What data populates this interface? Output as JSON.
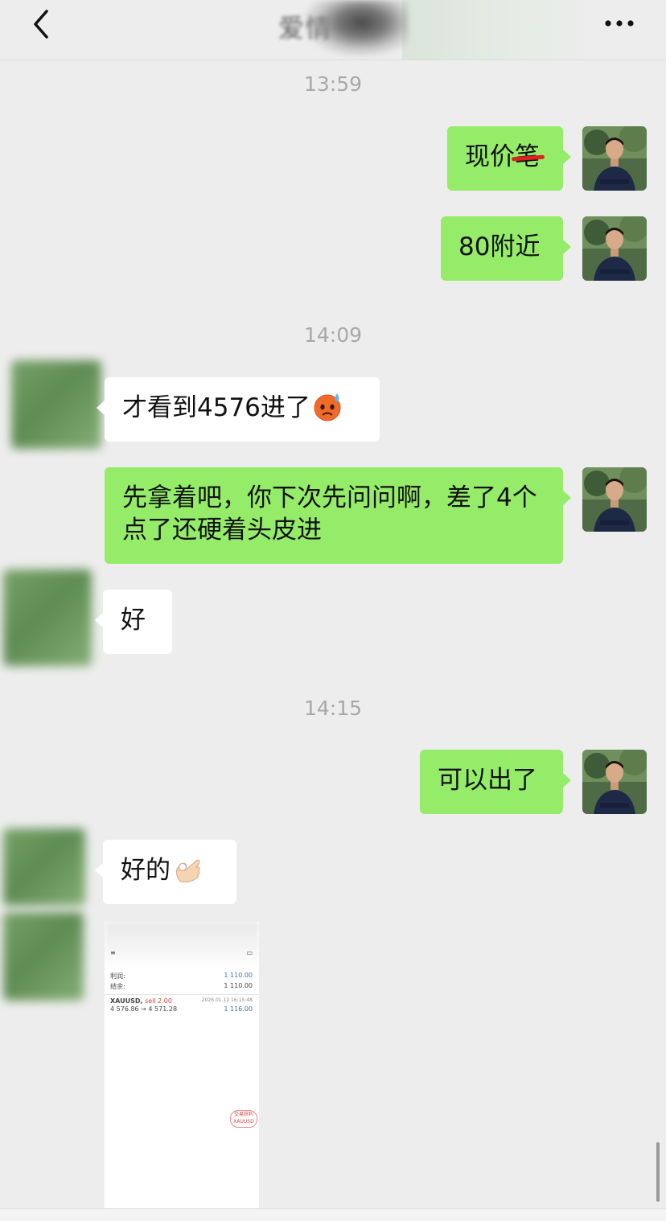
{
  "header": {
    "title": "爱情",
    "back_icon": "chevron-left-icon",
    "more_icon": "more-dots-icon"
  },
  "timestamps": [
    "13:59",
    "14:09",
    "14:15"
  ],
  "messages": [
    {
      "side": "out",
      "text_main": "现价",
      "text_struck": "笔"
    },
    {
      "side": "out",
      "text": "80附近"
    },
    {
      "side": "in",
      "text": "才看到4576进了",
      "emoji": "anxious-face-with-sweat-icon"
    },
    {
      "side": "out",
      "text": "先拿着吧，你下次先问问啊，差了4个点了还硬着头皮进"
    },
    {
      "side": "in",
      "text": "好"
    },
    {
      "side": "out",
      "text": "可以出了"
    },
    {
      "side": "in",
      "text": "好的",
      "emoji": "ok-hand-icon"
    }
  ],
  "screenshot": {
    "label_profit": "利润:",
    "value_profit": "1 110.00",
    "label_balance": "结余:",
    "value_balance": "1 110.00",
    "symbol": "XAUUSD,",
    "action": "sell 2.00",
    "date": "2026.01.12 16:15:48",
    "prices": "4 576.86 → 4 571.28",
    "trade_profit": "1 116.00",
    "stamp_line1": "交易获利",
    "stamp_line2": "XAUUSD"
  },
  "colors": {
    "background": "#ededed",
    "outgoing_bubble": "#95ec69",
    "incoming_bubble": "#ffffff",
    "timestamp": "#a8a8a8"
  }
}
